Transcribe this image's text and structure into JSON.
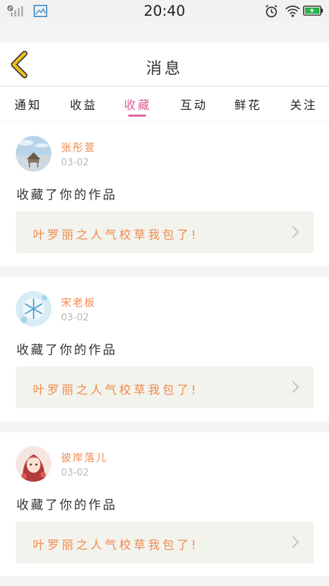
{
  "status_bar": {
    "time": "20:40",
    "icons": [
      "no-signal-icon",
      "gallery-icon",
      "alarm-icon",
      "wifi-icon",
      "battery-icon"
    ],
    "battery_color": "#2bb24c"
  },
  "header": {
    "title": "消息",
    "back_icon": "chevron-left-icon",
    "back_color": "#f0c020"
  },
  "tabs": {
    "items": [
      {
        "label": "通知"
      },
      {
        "label": "收益"
      },
      {
        "label": "收藏"
      },
      {
        "label": "互动"
      },
      {
        "label": "鲜花"
      },
      {
        "label": "关注"
      }
    ],
    "active": "收藏",
    "active_color": "#e0609a"
  },
  "messages": [
    {
      "username": "张彤萱",
      "date": "03-02",
      "action": "收藏了你的作品",
      "work_title": "叶罗丽之人气校草我包了!",
      "avatar": "beach-hut-avatar"
    },
    {
      "username": "宋老板",
      "date": "03-02",
      "action": "收藏了你的作品",
      "work_title": "叶罗丽之人气校草我包了!",
      "avatar": "snowflake-avatar"
    },
    {
      "username": "彼岸落儿",
      "date": "03-02",
      "action": "收藏了你的作品",
      "work_title": "叶罗丽之人气校草我包了!",
      "avatar": "anime-girl-avatar"
    }
  ],
  "colors": {
    "accent_orange": "#f08a4a",
    "work_box_bg": "#f3f3ee",
    "page_bg": "#f4f4f4"
  }
}
